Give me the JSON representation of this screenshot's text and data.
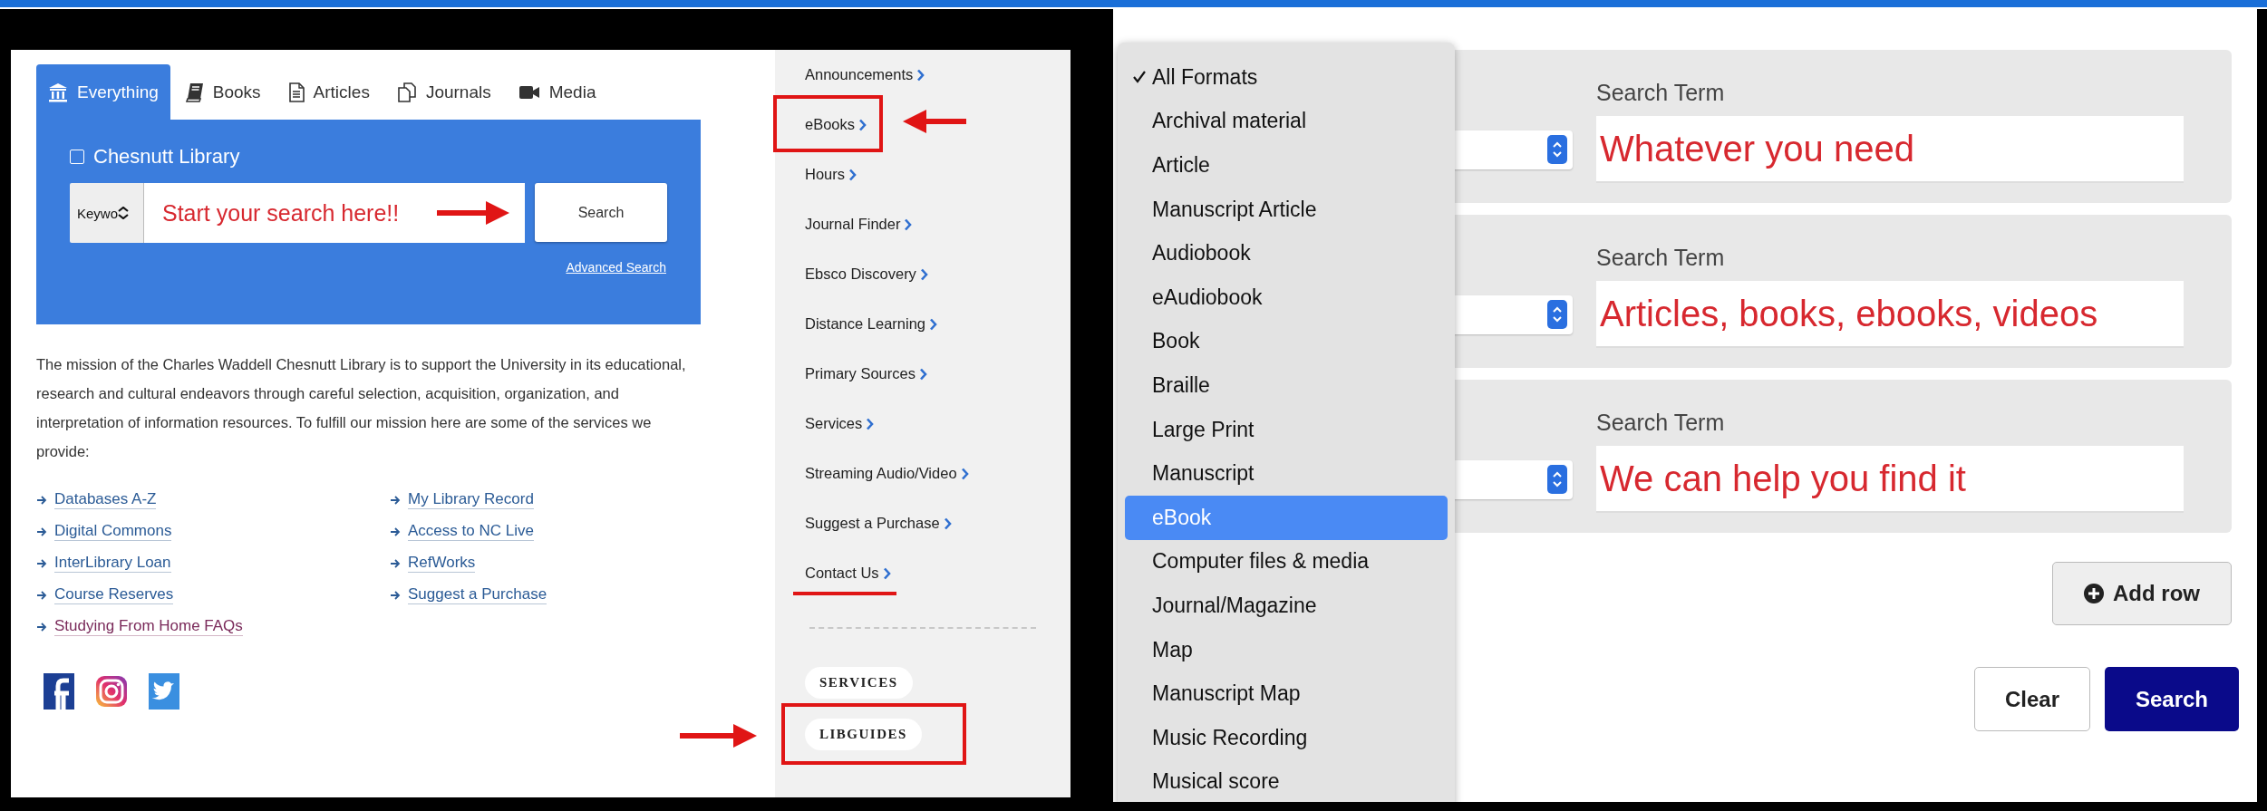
{
  "library": {
    "tabs": [
      {
        "label": "Everything",
        "kind": "building",
        "selected": true
      },
      {
        "label": "Books",
        "kind": "book",
        "selected": false
      },
      {
        "label": "Articles",
        "kind": "document",
        "selected": false
      },
      {
        "label": "Journals",
        "kind": "documents",
        "selected": false
      },
      {
        "label": "Media",
        "kind": "camera",
        "selected": false
      }
    ],
    "scope": {
      "label": "Chesnutt Library",
      "checked": false
    },
    "search_type": "Keywo",
    "search_value": "Start your search here!!",
    "search_button": "Search",
    "advanced_search": "Advanced Search",
    "mission": "The mission of the Charles Waddell Chesnutt Library is to support the University in its educational, research and cultural endeavors through careful selection, acquisition, organization, and interpretation of information resources. To fulfill our mission here are some of the services we provide:",
    "link_columns": [
      {
        "links": [
          {
            "label": "Databases A-Z",
            "visited": false
          },
          {
            "label": "Digital Commons",
            "visited": false
          },
          {
            "label": "InterLibrary Loan",
            "visited": false
          },
          {
            "label": "Course Reserves",
            "visited": false
          },
          {
            "label": "Studying From Home FAQs",
            "visited": true
          }
        ]
      },
      {
        "links": [
          {
            "label": "My Library Record",
            "visited": false
          },
          {
            "label": "Access to NC Live",
            "visited": false
          },
          {
            "label": "RefWorks",
            "visited": false
          },
          {
            "label": "Suggest a Purchase",
            "visited": false
          }
        ]
      }
    ]
  },
  "sidebar": {
    "items": [
      {
        "label": "Announcements",
        "kind": "plain"
      },
      {
        "label": "eBooks",
        "kind": "boxed"
      },
      {
        "label": "Hours",
        "kind": "plain"
      },
      {
        "label": "Journal Finder",
        "kind": "plain"
      },
      {
        "label": "Ebsco Discovery",
        "kind": "plain"
      },
      {
        "label": "Distance Learning",
        "kind": "plain"
      },
      {
        "label": "Primary Sources",
        "kind": "plain"
      },
      {
        "label": "Services",
        "kind": "plain"
      },
      {
        "label": "Streaming Audio/Video",
        "kind": "plain"
      },
      {
        "label": "Suggest a Purchase",
        "kind": "plain"
      },
      {
        "label": "Contact Us",
        "kind": "underlined"
      }
    ],
    "tags": [
      {
        "label": "SERVICES",
        "kind": "plain"
      },
      {
        "label": "LIBGUIDES",
        "kind": "boxed"
      }
    ]
  },
  "format_menu": {
    "items": [
      {
        "label": "All Formats",
        "checked": true,
        "selected": false
      },
      {
        "label": "Archival material",
        "checked": false,
        "selected": false
      },
      {
        "label": "Article",
        "checked": false,
        "selected": false
      },
      {
        "label": "Manuscript Article",
        "checked": false,
        "selected": false
      },
      {
        "label": "Audiobook",
        "checked": false,
        "selected": false
      },
      {
        "label": "eAudiobook",
        "checked": false,
        "selected": false
      },
      {
        "label": "Book",
        "checked": false,
        "selected": false
      },
      {
        "label": "Braille",
        "checked": false,
        "selected": false
      },
      {
        "label": "Large Print",
        "checked": false,
        "selected": false
      },
      {
        "label": "Manuscript",
        "checked": false,
        "selected": false
      },
      {
        "label": "eBook",
        "checked": false,
        "selected": true
      },
      {
        "label": "Computer files & media",
        "checked": false,
        "selected": false
      },
      {
        "label": "Journal/Magazine",
        "checked": false,
        "selected": false
      },
      {
        "label": "Map",
        "checked": false,
        "selected": false
      },
      {
        "label": "Manuscript Map",
        "checked": false,
        "selected": false
      },
      {
        "label": "Music Recording",
        "checked": false,
        "selected": false
      },
      {
        "label": "Musical score",
        "checked": false,
        "selected": false
      }
    ]
  },
  "search_rows": [
    {
      "label": "Search Term",
      "value": "Whatever you need"
    },
    {
      "label": "Search Term",
      "value": "Articles, books, ebooks, videos"
    },
    {
      "label": "Search Term",
      "value": "We can help you find it"
    }
  ],
  "add_row": "Add row",
  "buttons": [
    {
      "label": "Clear",
      "kind": "secondary"
    },
    {
      "label": "Search",
      "kind": "primary"
    }
  ]
}
